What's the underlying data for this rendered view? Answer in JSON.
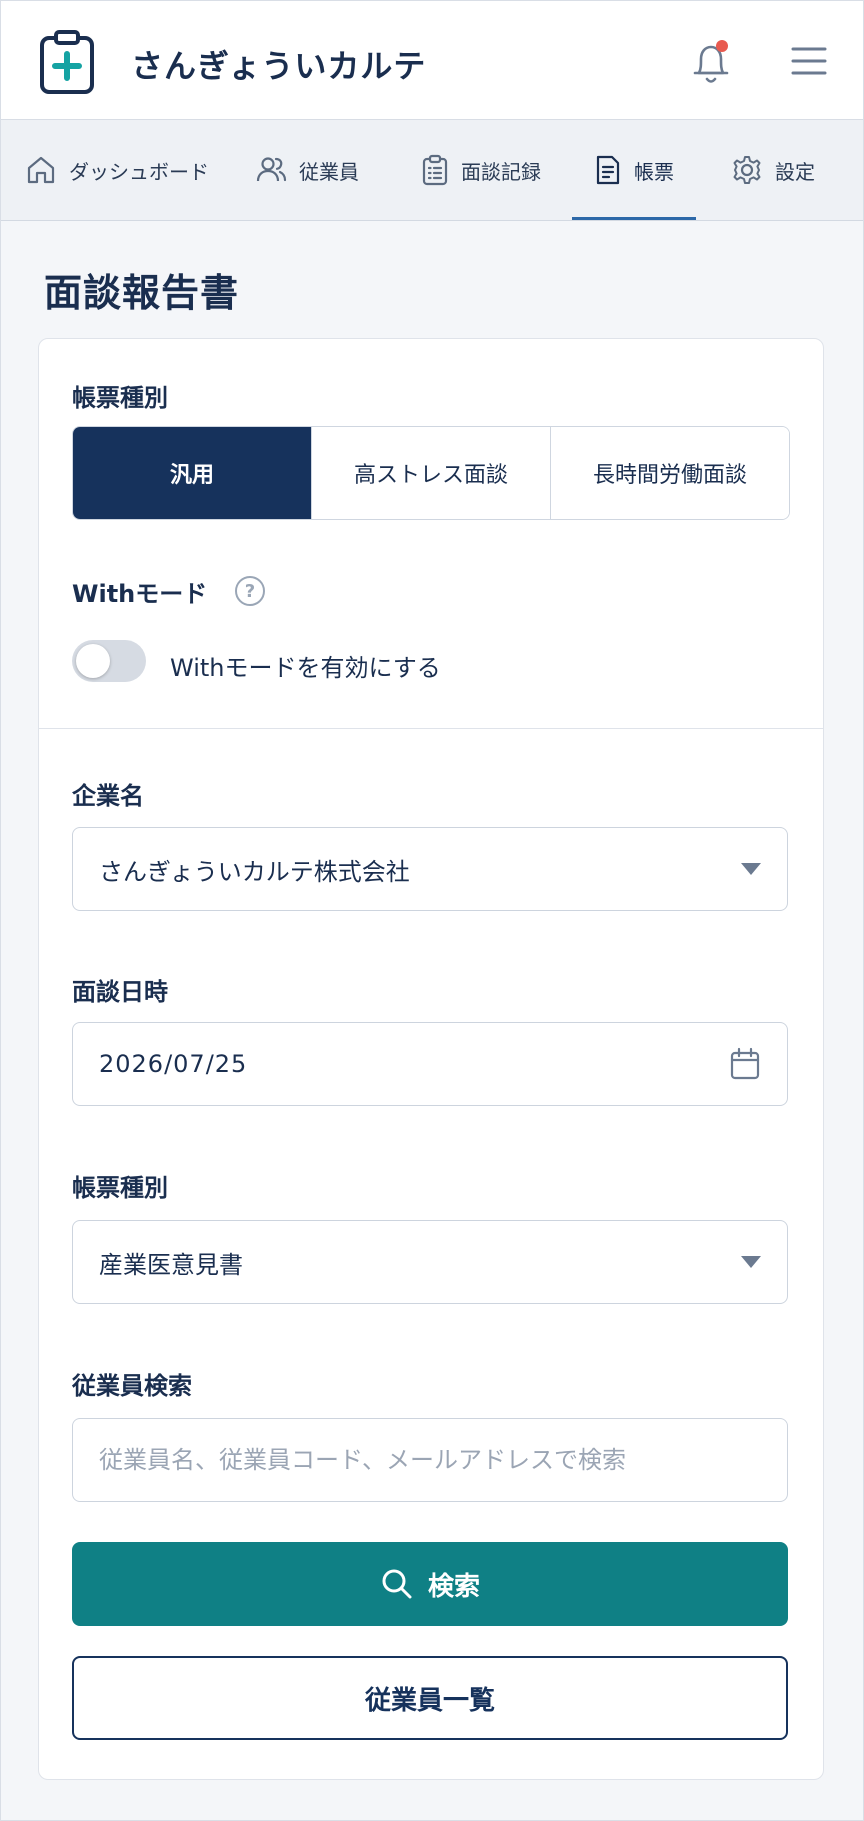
{
  "app": {
    "title": "さんぎょういカルテ",
    "accent": "#0f8085",
    "primary": "#16325c",
    "notification_dot": "#e85a4f"
  },
  "nav": {
    "items": [
      {
        "label": "ダッシュボード",
        "icon": "home-icon"
      },
      {
        "label": "従業員",
        "icon": "users-icon"
      },
      {
        "label": "面談記録",
        "icon": "clipboard-list-icon"
      },
      {
        "label": "帳票",
        "icon": "document-icon",
        "active": true
      },
      {
        "label": "設定",
        "icon": "gear-icon"
      }
    ]
  },
  "page": {
    "title": "面談報告書"
  },
  "form_type": {
    "label": "帳票種別",
    "options": [
      "汎用",
      "高ストレス面談",
      "長時間労働面談"
    ],
    "selected": "汎用"
  },
  "with_mode": {
    "label": "Withモード",
    "help": "?",
    "toggle_label": "Withモードを有効にする",
    "enabled": false
  },
  "company": {
    "label": "企業名",
    "value": "さんぎょういカルテ株式会社"
  },
  "interview_date": {
    "label": "面談日時",
    "value": "2026/07/25"
  },
  "document_type": {
    "label": "帳票種別",
    "value": "産業医意見書"
  },
  "employee_search": {
    "label": "従業員検索",
    "placeholder": "従業員名、従業員コード、メールアドレスで検索"
  },
  "buttons": {
    "search": "検索",
    "employee_list": "従業員一覧"
  }
}
